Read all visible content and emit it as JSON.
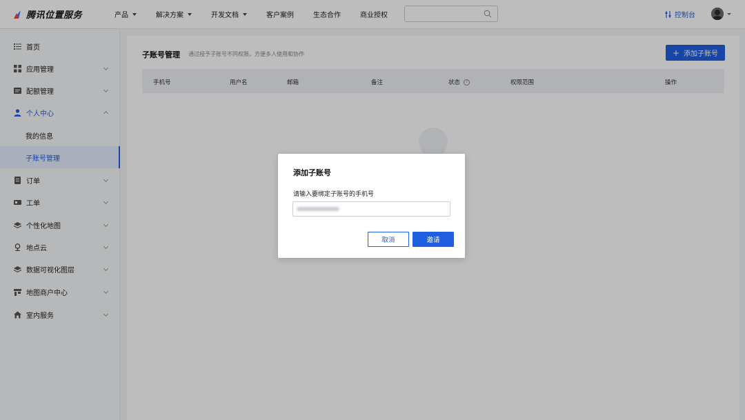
{
  "brand": {
    "name": "腾讯位置服务",
    "accent": "#1f5fe0"
  },
  "topnav": {
    "items": [
      {
        "label": "产品",
        "has_dropdown": true
      },
      {
        "label": "解决方案",
        "has_dropdown": true
      },
      {
        "label": "开发文档",
        "has_dropdown": true
      },
      {
        "label": "客户案例",
        "has_dropdown": false
      },
      {
        "label": "生态合作",
        "has_dropdown": false
      },
      {
        "label": "商业授权",
        "has_dropdown": false
      }
    ],
    "search_placeholder": "",
    "console_label": "控制台"
  },
  "sidebar": {
    "items": [
      {
        "label": "首页",
        "icon": "list-icon"
      },
      {
        "label": "应用管理",
        "icon": "grid-icon"
      },
      {
        "label": "配额管理",
        "icon": "quota-icon"
      },
      {
        "label": "个人中心",
        "icon": "user-icon"
      },
      {
        "label": "我的信息"
      },
      {
        "label": "子账号管理"
      },
      {
        "label": "订单",
        "icon": "order-icon"
      },
      {
        "label": "工单",
        "icon": "ticket-icon"
      },
      {
        "label": "个性化地图",
        "icon": "layers-icon"
      },
      {
        "label": "地点云",
        "icon": "location-pin-icon"
      },
      {
        "label": "数据可视化图层",
        "icon": "layers-icon"
      },
      {
        "label": "地图商户中心",
        "icon": "store-icon"
      },
      {
        "label": "室内服务",
        "icon": "building-icon"
      }
    ]
  },
  "main": {
    "title": "子账号管理",
    "description": "通过授予子账号不同权限，方便多人使用和协作",
    "add_button_label": "添加子账号",
    "table_headers": [
      "手机号",
      "用户名",
      "邮箱",
      "备注",
      "状态",
      "权限范围",
      "操作"
    ]
  },
  "modal": {
    "title": "添加子账号",
    "label": "请输入要绑定子账号的手机号",
    "input_value": "",
    "cancel_label": "取消",
    "invite_label": "邀请"
  }
}
